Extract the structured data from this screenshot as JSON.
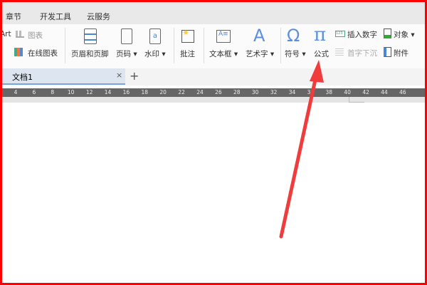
{
  "menu": [
    "章节",
    "开发工具",
    "云服务"
  ],
  "ribbon": {
    "art": "Art",
    "chart": "图表",
    "online_chart": "在线图表",
    "header_footer": "页眉和页脚",
    "page_number": "页码",
    "watermark": "水印",
    "comment": "批注",
    "text_box": "文本框",
    "word_art": "艺术字",
    "symbol": "符号",
    "formula": "公式",
    "insert_number": "插入数字",
    "drop_cap": "首字下沉",
    "object": "对象",
    "attachment": "附件"
  },
  "tabs": [
    {
      "label": "文档1"
    }
  ],
  "ruler": [
    "4",
    "6",
    "8",
    "10",
    "12",
    "14",
    "16",
    "18",
    "20",
    "22",
    "24",
    "26",
    "28",
    "30",
    "32",
    "34",
    "36",
    "38",
    "40",
    "42",
    "44",
    "46"
  ],
  "colors": {
    "arrow": "#f03c3c",
    "accent": "#4a86d8"
  }
}
